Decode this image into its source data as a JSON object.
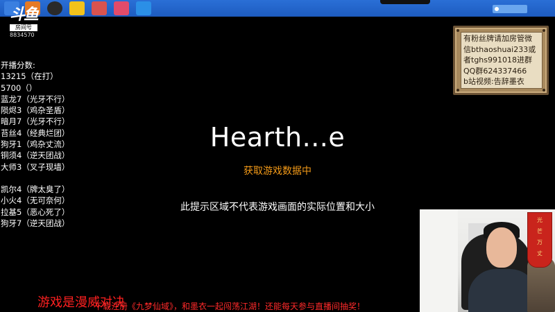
{
  "room": {
    "logo_text": "斗鱼",
    "tag_label": "房间号",
    "room_number": "8834570"
  },
  "scoreboard": {
    "title": "开播分数:",
    "scores": [
      "13215（在打）",
      "5700（）"
    ],
    "group_one": [
      "蓝龙7（光牙不行）",
      "陨烬3（鸡杂圣盾）",
      "暗月7（光牙不行）",
      "苔丝4（经典烂团）",
      "狗牙1（鸡杂丈流）",
      "铜须4（逆天团战）",
      "大师3（叉子现墙）"
    ],
    "group_two": [
      "凯尔4（牌太臭了）",
      "小火4（无可奈何）",
      "拉基5（恶心死了）",
      "狗牙7（逆天团战）"
    ]
  },
  "sign": {
    "lines": [
      "有粉丝牌请加房管微",
      "信bthaoshuai233或",
      "者tghs991018进群",
      "QQ群624337466",
      "b站视频:告辞墨衣"
    ]
  },
  "game": {
    "title": "Hearth...e",
    "loading_text": "获取游戏数据中",
    "hint_text": "此提示区域不代表游戏画面的实际位置和大小"
  },
  "couplet": {
    "chars": [
      "光",
      "芒",
      "万",
      "丈"
    ]
  },
  "bottom": {
    "overlay_text": "游戏是漫威对决",
    "marquee_text": "下载注册《九梦仙域》，和墨衣一起闯荡江湖！还能每天参与直播间抽奖！"
  },
  "colors": {
    "taskbar": "#1d5bbf",
    "loading": "#f39a18",
    "marquee": "#ff2a2a"
  }
}
